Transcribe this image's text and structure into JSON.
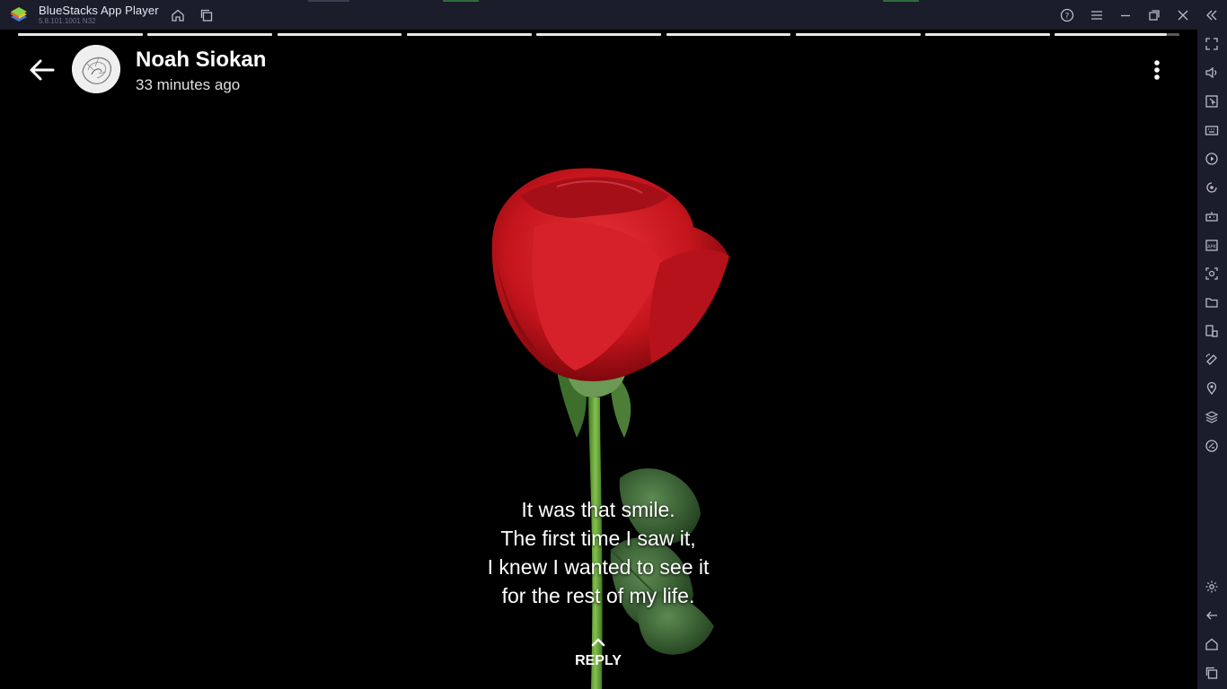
{
  "window": {
    "app_title": "BlueStacks App Player",
    "version": "5.8.101.1001 N32",
    "titlebar_icons": [
      "home-icon",
      "multi-instance-icon",
      "help-icon",
      "menu-icon",
      "minimize-icon",
      "restore-icon",
      "close-icon",
      "collapse-sidebar-icon"
    ]
  },
  "sidebar": {
    "top_icons": [
      "fullscreen-icon",
      "volume-icon",
      "cursor-icon",
      "keyboard-icon",
      "macro-icon",
      "sync-icon",
      "game-controls-icon",
      "apk-icon",
      "screenshot-icon",
      "folder-icon",
      "resize-icon",
      "rotate-icon",
      "location-icon",
      "layers-icon",
      "eco-mode-icon"
    ],
    "bottom_icons": [
      "settings-icon",
      "back-icon",
      "home-icon",
      "recents-icon"
    ]
  },
  "story": {
    "author": "Noah Siokan",
    "time_ago": "33 minutes ago",
    "segments_total": 9,
    "caption_lines": [
      "It was that smile.",
      "The first time I saw it,",
      "I knew I wanted to see it",
      "for the rest of my life."
    ],
    "reply_label": "REPLY"
  },
  "colors": {
    "chrome": "#1b1d2b",
    "story_bg": "#000000",
    "rose": "#c8141c",
    "stem": "#5f9a3c"
  }
}
